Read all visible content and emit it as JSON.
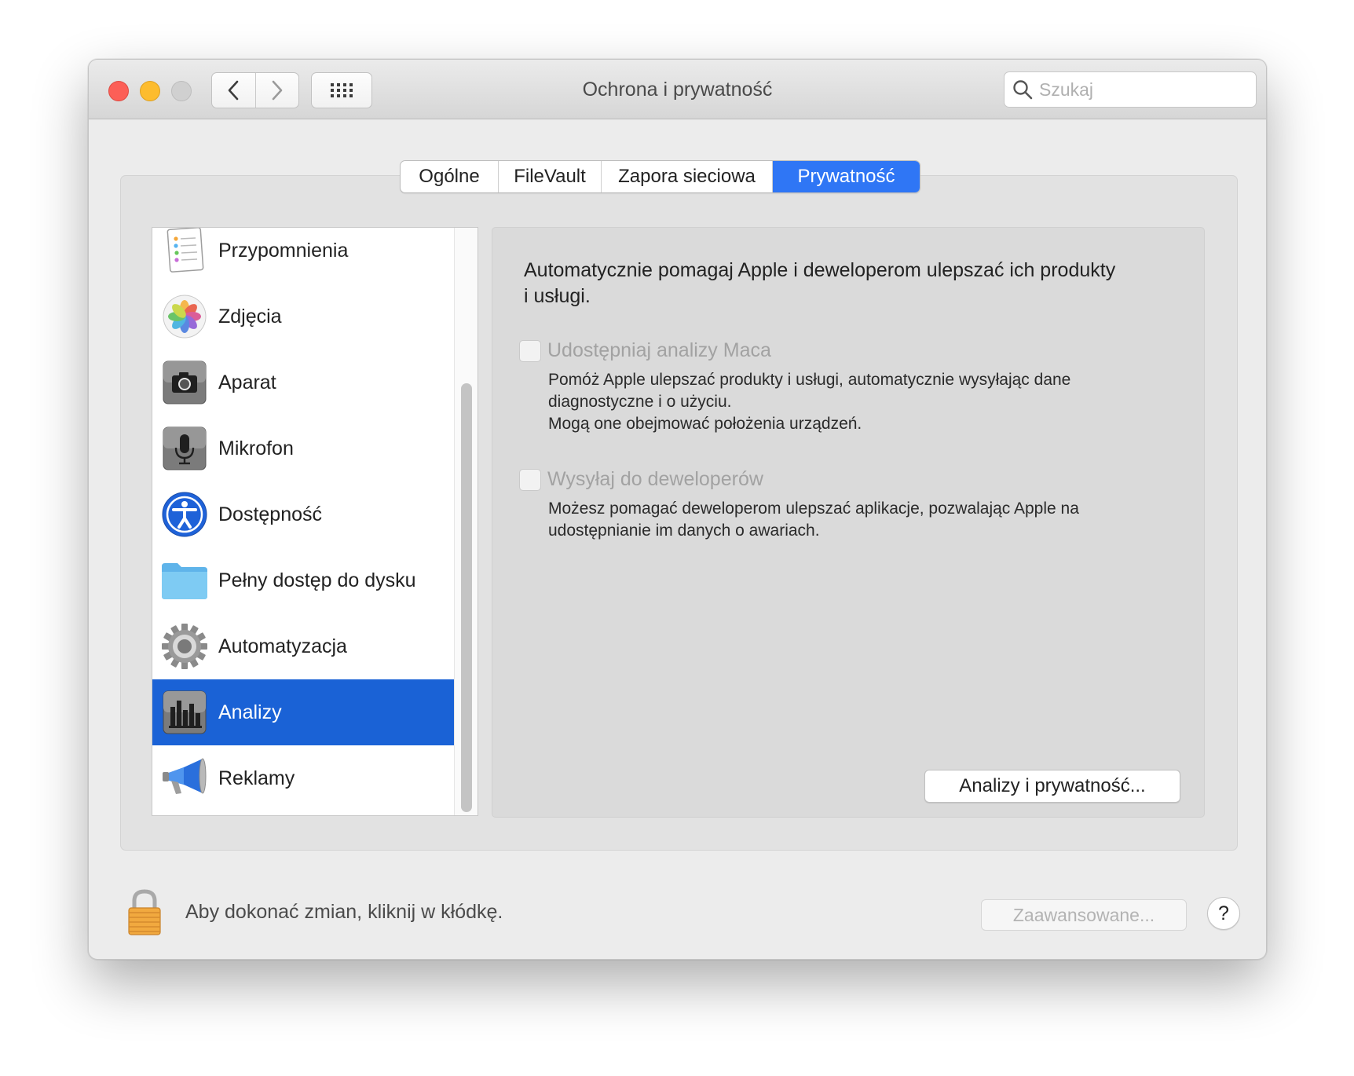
{
  "window": {
    "title": "Ochrona i prywatność",
    "search_placeholder": "Szukaj"
  },
  "tabs": [
    {
      "label": "Ogólne",
      "active": false
    },
    {
      "label": "FileVault",
      "active": false
    },
    {
      "label": "Zapora sieciowa",
      "active": false
    },
    {
      "label": "Prywatność",
      "active": true
    }
  ],
  "sidebar": {
    "items": [
      {
        "label": "Przypomnienia",
        "icon": "reminders-icon"
      },
      {
        "label": "Zdjęcia",
        "icon": "photos-icon"
      },
      {
        "label": "Aparat",
        "icon": "camera-icon"
      },
      {
        "label": "Mikrofon",
        "icon": "microphone-icon"
      },
      {
        "label": "Dostępność",
        "icon": "accessibility-icon"
      },
      {
        "label": "Pełny dostęp do dysku",
        "icon": "folder-icon"
      },
      {
        "label": "Automatyzacja",
        "icon": "gear-icon"
      },
      {
        "label": "Analizy",
        "icon": "analytics-chart-icon",
        "selected": true
      },
      {
        "label": "Reklamy",
        "icon": "megaphone-icon"
      }
    ]
  },
  "detail": {
    "headline": "Automatycznie pomagaj Apple i deweloperom ulepszać ich produkty i usługi.",
    "share_mac_label": "Udostępniaj analizy Maca",
    "share_mac_desc_1": "Pomóż Apple ulepszać produkty i usługi, automatycznie wysyłając dane diagnostyczne i o użyciu.",
    "share_mac_desc_2": "Mogą one obejmować położenia urządzeń.",
    "share_dev_label": "Wysyłaj do deweloperów",
    "share_dev_desc": "Możesz pomagać deweloperom ulepszać aplikacje, pozwalając Apple na udostępnianie im danych o awariach.",
    "privacy_button": "Analizy i prywatność..."
  },
  "footer": {
    "lock_text": "Aby dokonać zmian, kliknij w kłódkę.",
    "advanced_button": "Zaawansowane...",
    "help_button": "?"
  },
  "colors": {
    "accent": "#2f76f5",
    "selection": "#1a62d6"
  }
}
